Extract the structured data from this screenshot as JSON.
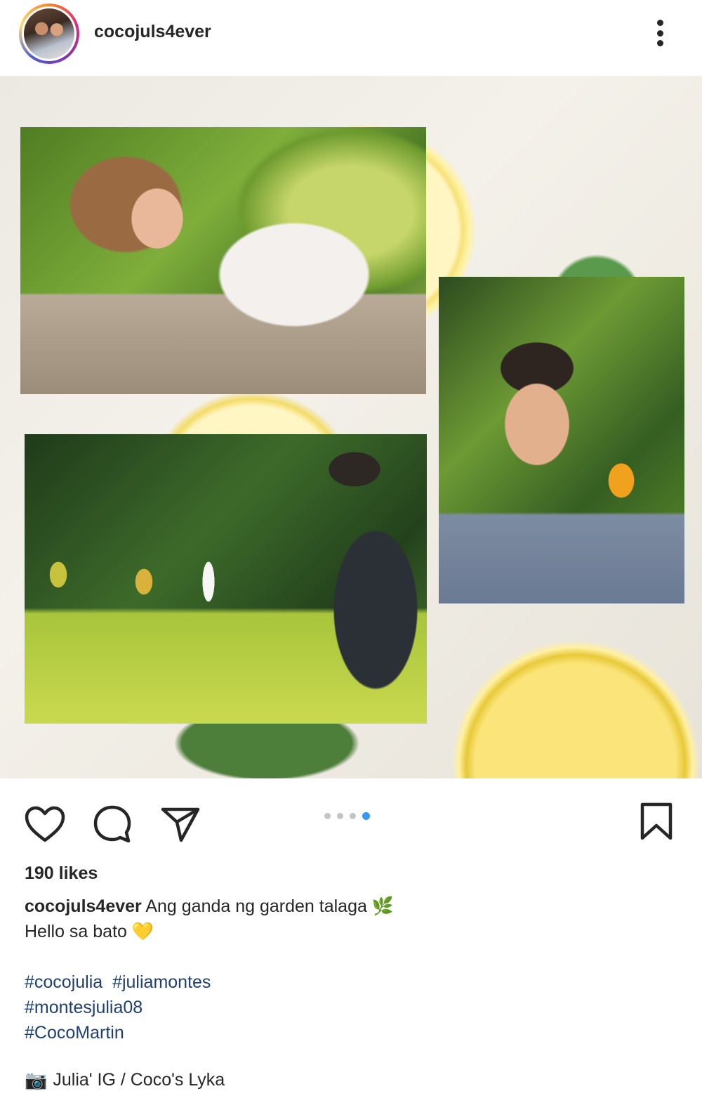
{
  "post": {
    "username": "cocojuls4ever",
    "likes": "190 likes",
    "caption": {
      "user": "cocojuls4ever",
      "line1": "Ang ganda ng garden talaga 🌿",
      "line2": "Hello sa bato 💛"
    },
    "hashtags": [
      "#cocojulia  #juliamontes",
      "#montesjulia08",
      "#CocoMartin"
    ],
    "credit": "Julia' IG / Coco's Lyka",
    "credit_icon": "📷"
  },
  "carousel": {
    "total": 4,
    "active_index": 4
  },
  "colors": {
    "pager_active": "#3897f0",
    "hashtag": "#1f3f73"
  },
  "icons": [
    "more-icon",
    "heart-icon",
    "comment-icon",
    "share-icon",
    "bookmark-icon",
    "camera-icon"
  ]
}
